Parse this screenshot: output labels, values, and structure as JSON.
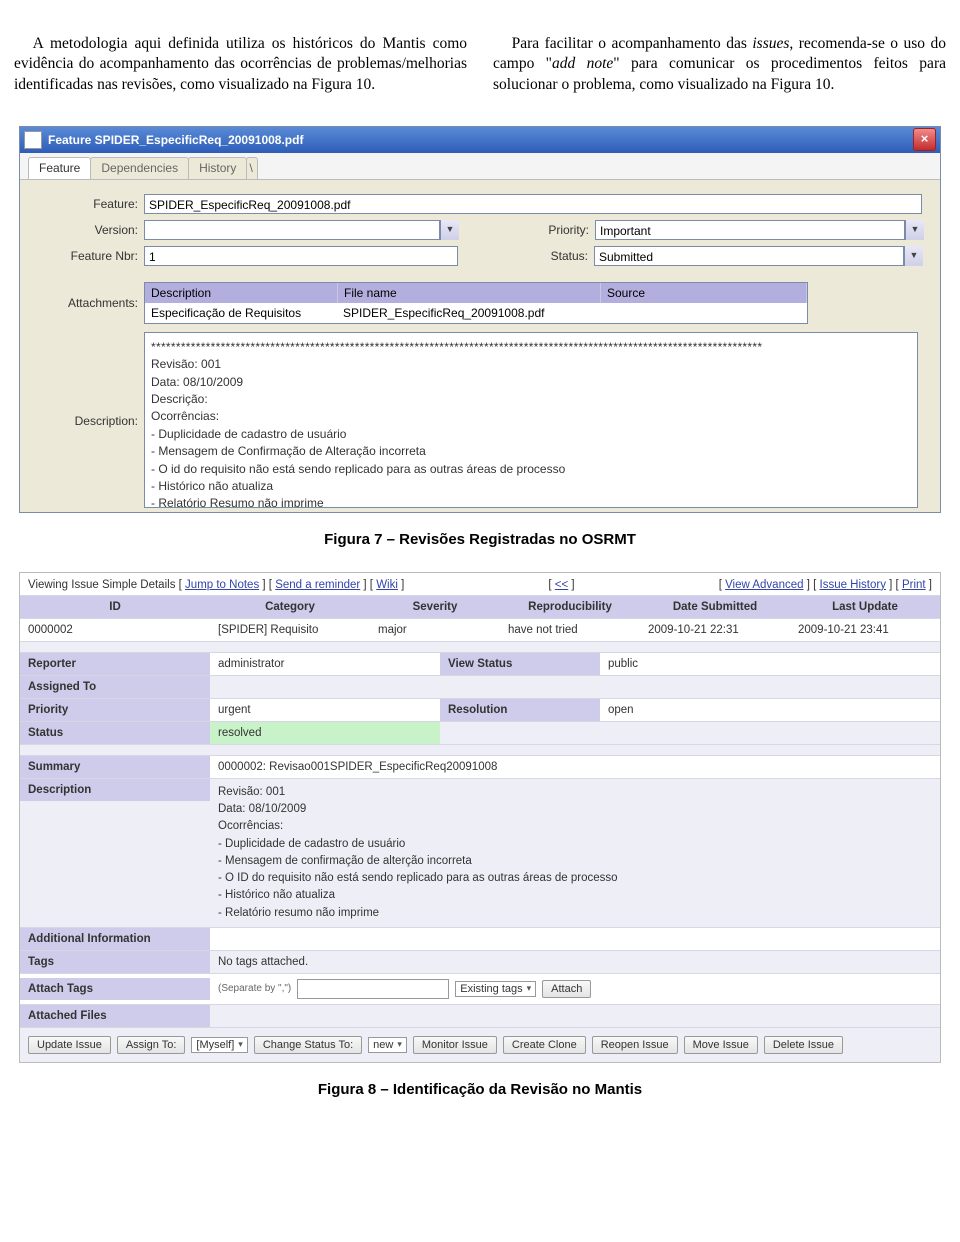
{
  "columns": {
    "left": "A metodologia aqui definida utiliza os históricos do Mantis como evidência do acompanhamento das ocorrências de problemas/melhorias identificadas nas revisões, como visualizado na Figura 10.",
    "right_a": "Para facilitar o acompanhamento das ",
    "right_issues": "issues",
    "right_b": ", recomenda-se o uso do campo \"",
    "right_addnote": "add note",
    "right_c": "\" para comunicar os procedimentos feitos para solucionar o problema, como visualizado na Figura 10."
  },
  "captions": {
    "fig7": "Figura 7 – Revisões Registradas no OSRMT",
    "fig8": "Figura 8 – Identificação da Revisão no Mantis"
  },
  "osrmt": {
    "title": "Feature SPIDER_EspecificReq_20091008.pdf",
    "tabs": [
      "Feature",
      "Dependencies",
      "History"
    ],
    "labels": {
      "feature": "Feature:",
      "version": "Version:",
      "feature_nbr": "Feature Nbr:",
      "priority": "Priority:",
      "status": "Status:",
      "attachments": "Attachments:",
      "description": "Description:"
    },
    "values": {
      "feature": "SPIDER_EspecificReq_20091008.pdf",
      "version": "",
      "feature_nbr": "1",
      "priority": "Important",
      "status": "Submitted"
    },
    "attach_headers": [
      "Description",
      "File name",
      "Source"
    ],
    "attach_row": [
      "Especificação de Requisitos",
      "SPIDER_EspecificReq_20091008.pdf",
      ""
    ],
    "description_lines": [
      "***************************************************************************************************************************",
      "Revisão: 001",
      "Data: 08/10/2009",
      "Descrição:",
      "Ocorrências:",
      "- Duplicidade de cadastro de usuário",
      "- Mensagem de Confirmação de Alteração incorreta",
      "- O id do requisito não está sendo replicado para as outras áreas de processo",
      "- Histórico não atualiza",
      "- Relatório Resumo não imprime",
      "***************************************************************************************************************************",
      "**************************************************************************************************************************|"
    ]
  },
  "mantis": {
    "topbar": {
      "left_a": "Viewing Issue Simple Details",
      "jump": "Jump to Notes",
      "send": "Send a reminder",
      "wiki": "Wiki",
      "center": "<<",
      "va": "View Advanced",
      "ih": "Issue History",
      "pr": "Print"
    },
    "cols": [
      "ID",
      "Category",
      "Severity",
      "Reproducibility",
      "Date Submitted",
      "Last Update"
    ],
    "row1": [
      "0000002",
      "[SPIDER] Requisito",
      "major",
      "have not tried",
      "2009-10-21 22:31",
      "2009-10-21 23:41"
    ],
    "grid": {
      "reporter_l": "Reporter",
      "reporter_v": "administrator",
      "viewstatus_l": "View Status",
      "viewstatus_v": "public",
      "assigned_l": "Assigned To",
      "assigned_v": "",
      "priority_l": "Priority",
      "priority_v": "urgent",
      "resolution_l": "Resolution",
      "resolution_v": "open",
      "status_l": "Status",
      "status_v": "resolved",
      "summary_l": "Summary",
      "summary_v": "0000002: Revisao001SPIDER_EspecificReq20091008",
      "description_l": "Description",
      "addinfo_l": "Additional Information",
      "addinfo_v": "",
      "tags_l": "Tags",
      "tags_v": "No tags attached.",
      "attachtags_l": "Attach Tags",
      "attachtags_hint": "(Separate by \",\")",
      "existing": "Existing tags",
      "attach_btn": "Attach",
      "attached_l": "Attached Files"
    },
    "desc_lines": [
      "Revisão: 001",
      "Data: 08/10/2009",
      "Ocorrências:",
      " - Duplicidade de cadastro de usuário",
      " - Mensagem de confirmação de alterção incorreta",
      " - O ID do requisito não está sendo replicado para as outras áreas de processo",
      " - Histórico não atualiza",
      " - Relatório resumo não imprime"
    ],
    "buttons": {
      "update": "Update Issue",
      "assign": "Assign To:",
      "assign_opt": "[Myself]",
      "change": "Change Status To:",
      "change_opt": "new",
      "monitor": "Monitor Issue",
      "clone": "Create Clone",
      "reopen": "Reopen Issue",
      "move": "Move Issue",
      "delete": "Delete Issue"
    }
  }
}
